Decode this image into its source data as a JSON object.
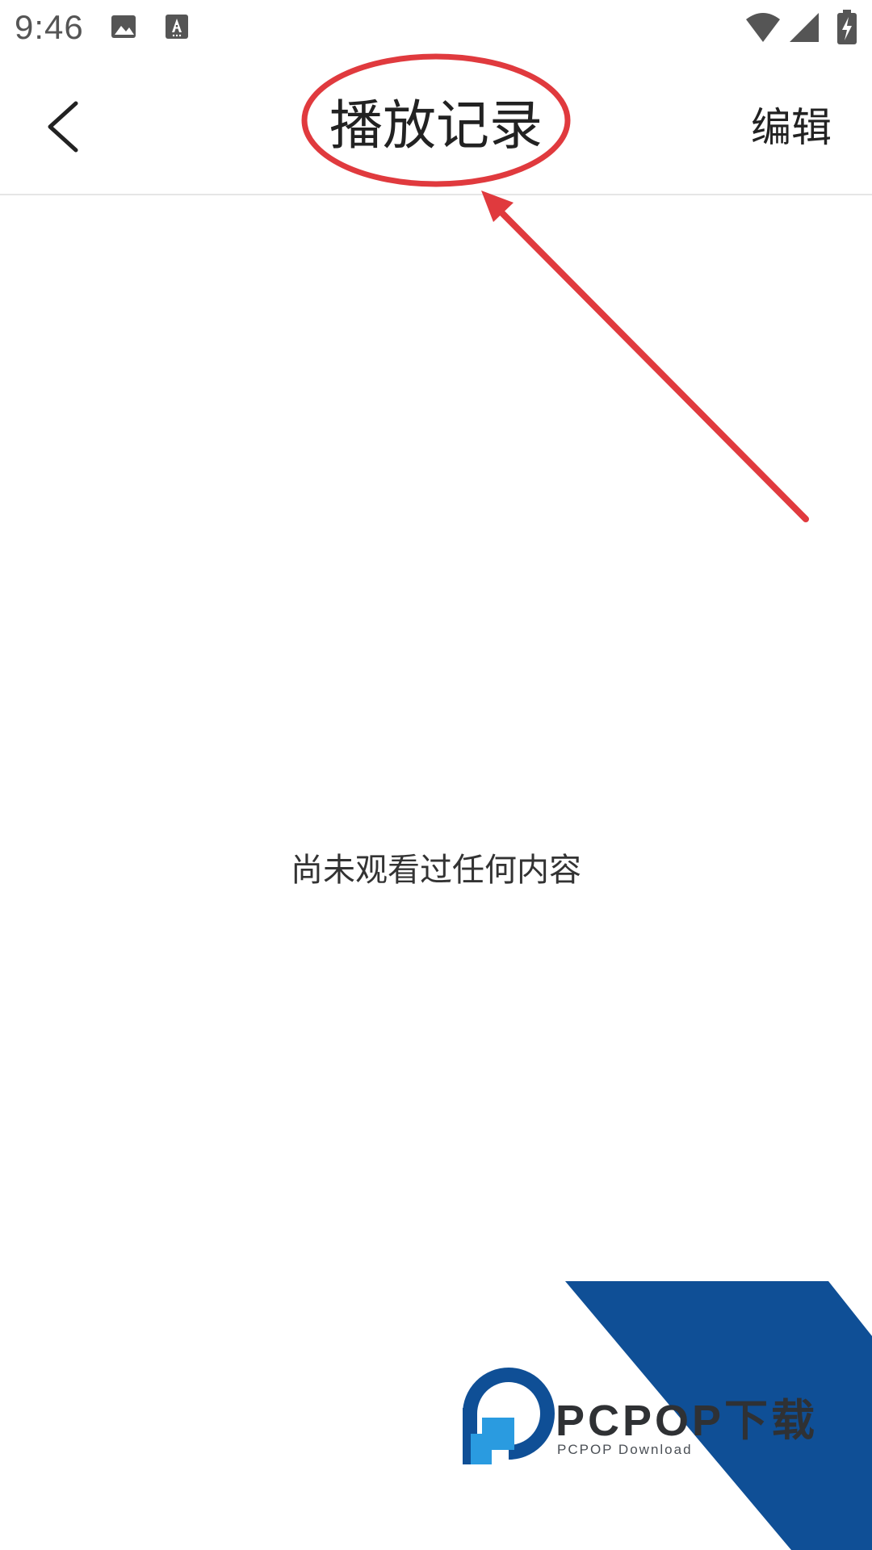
{
  "status_bar": {
    "time": "9:46",
    "icons": [
      "image-icon",
      "text-a-icon",
      "wifi-icon",
      "signal-icon",
      "battery-charging-icon"
    ]
  },
  "app_bar": {
    "back_icon": "chevron-left-icon",
    "title": "播放记录",
    "edit_label": "编辑"
  },
  "main": {
    "empty_message": "尚未观看过任何内容"
  },
  "watermark": {
    "brand": "PCPOP下载",
    "subtitle": "PCPOP Download"
  },
  "colors": {
    "annotation_red": "#e03a3e",
    "watermark_blue": "#0f4f96",
    "logo_light_blue": "#2a9be0",
    "divider": "#e6e6e6"
  }
}
